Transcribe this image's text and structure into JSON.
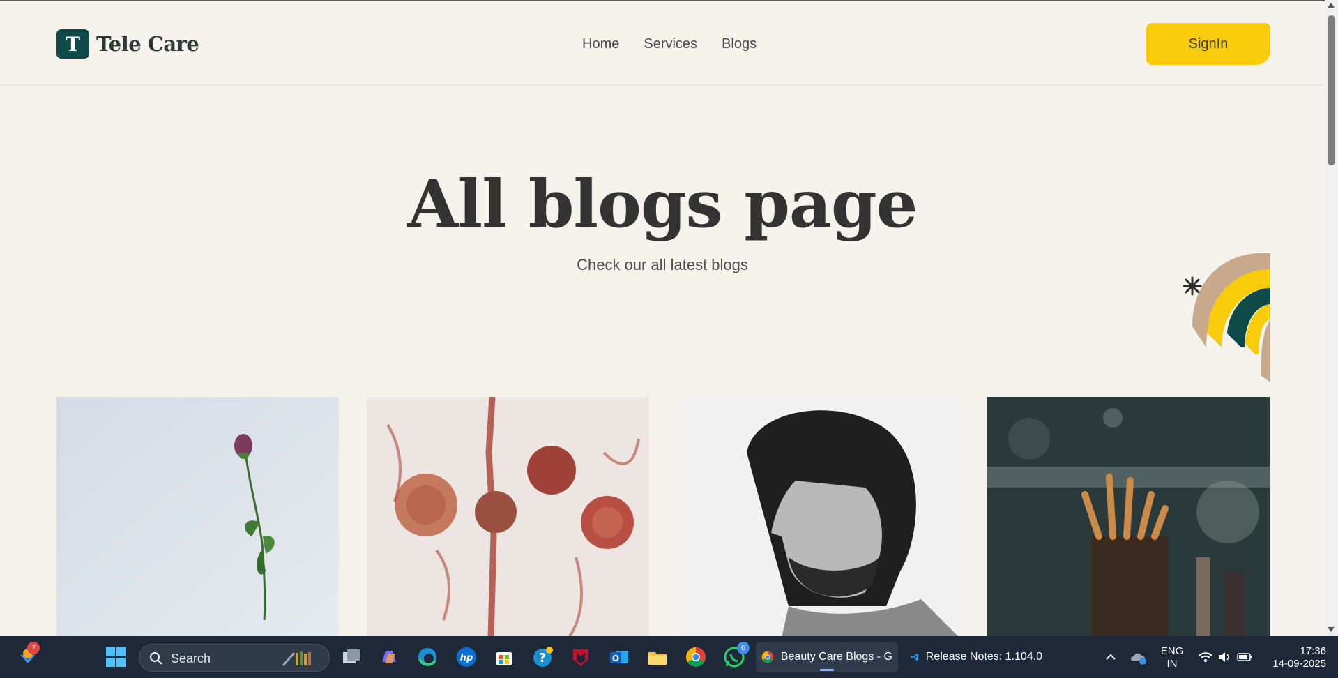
{
  "header": {
    "logo_letter": "T",
    "logo_text": "Tele Care",
    "nav": [
      "Home",
      "Services",
      "Blogs"
    ],
    "signin_label": "SignIn"
  },
  "hero": {
    "title": "All blogs page",
    "subtitle": "Check our all latest blogs"
  },
  "cards": [
    {
      "image": "purple-flower-on-light-background"
    },
    {
      "image": "crushed-red-blush-powder"
    },
    {
      "image": "curly-haired-bearded-man-portrait"
    },
    {
      "image": "makeup-brushes-in-holder"
    }
  ],
  "colors": {
    "background": "#f5f3ec",
    "brand_green": "#0e4a47",
    "accent_yellow": "#f8cc0b",
    "deco_tan": "#c9a98c"
  },
  "taskbar": {
    "widgets_badge": "7",
    "search_placeholder": "Search",
    "whatsapp_badge": "6",
    "chrome_window_title": "Beauty Care Blogs - G",
    "vscode_window_title": "Release Notes: 1.104.0",
    "language_line1": "ENG",
    "language_line2": "IN",
    "time": "17:36",
    "date": "14-09-2025",
    "icons": [
      "widgets-icon",
      "start-icon",
      "search-icon",
      "task-view-icon",
      "copilot-icon",
      "edge-icon",
      "hp-icon",
      "store-icon",
      "help-icon",
      "mcafee-icon",
      "outlook-icon",
      "file-explorer-icon",
      "chrome-icon",
      "whatsapp-icon",
      "vscode-icon",
      "chevron-up-icon",
      "onedrive-icon",
      "wifi-icon",
      "volume-icon",
      "battery-icon"
    ]
  }
}
